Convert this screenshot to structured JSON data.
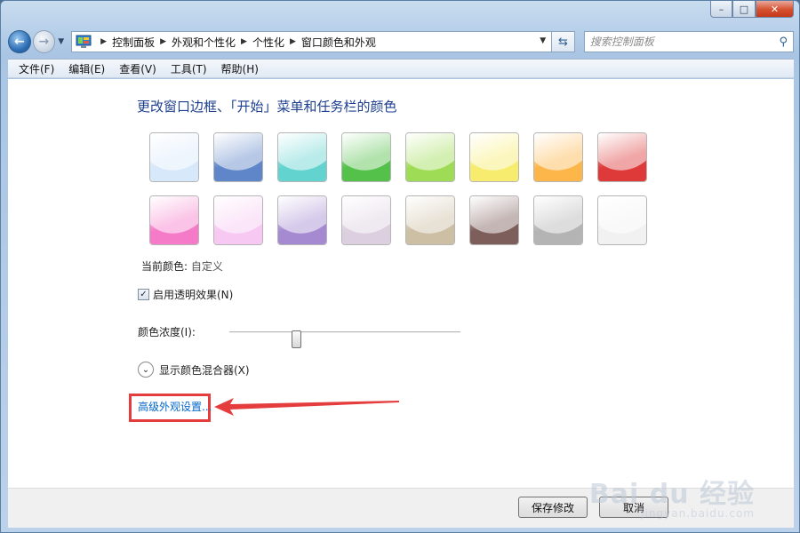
{
  "caption": {
    "minimize": "–",
    "maximize": "□",
    "close": "✕"
  },
  "nav": {
    "breadcrumbs": [
      "控制面板",
      "外观和个性化",
      "个性化",
      "窗口颜色和外观"
    ],
    "search_placeholder": "搜索控制面板"
  },
  "menu": [
    "文件(F)",
    "编辑(E)",
    "查看(V)",
    "工具(T)",
    "帮助(H)"
  ],
  "content": {
    "heading": "更改窗口边框、「开始」菜单和任务栏的颜色",
    "swatch_colors": [
      [
        "#d7e8fb",
        "#5f86c9",
        "#63d3d0",
        "#54c14a",
        "#9fdc55",
        "#f7ec6d",
        "#fdb64a",
        "#de3a3a"
      ],
      [
        "#f57bc9",
        "#f7c8f2",
        "#a58ad1",
        "#dccfe0",
        "#cdbfa4",
        "#7d5e5a",
        "#b4b4b4",
        "#f1f1f1"
      ]
    ],
    "current_label": "当前颜色:",
    "current_value": "自定义",
    "transparency_label": "启用透明效果(N)",
    "transparency_checked": true,
    "intensity_label": "颜色浓度(I):",
    "intensity_level": 0.28,
    "mixer_label": "显示颜色混合器(X)",
    "advanced_link": "高级外观设置..."
  },
  "footer": {
    "save": "保存修改",
    "cancel": "取消"
  },
  "watermark": {
    "brand": "Bai du 经验",
    "url": "jingyan.baidu.com"
  }
}
